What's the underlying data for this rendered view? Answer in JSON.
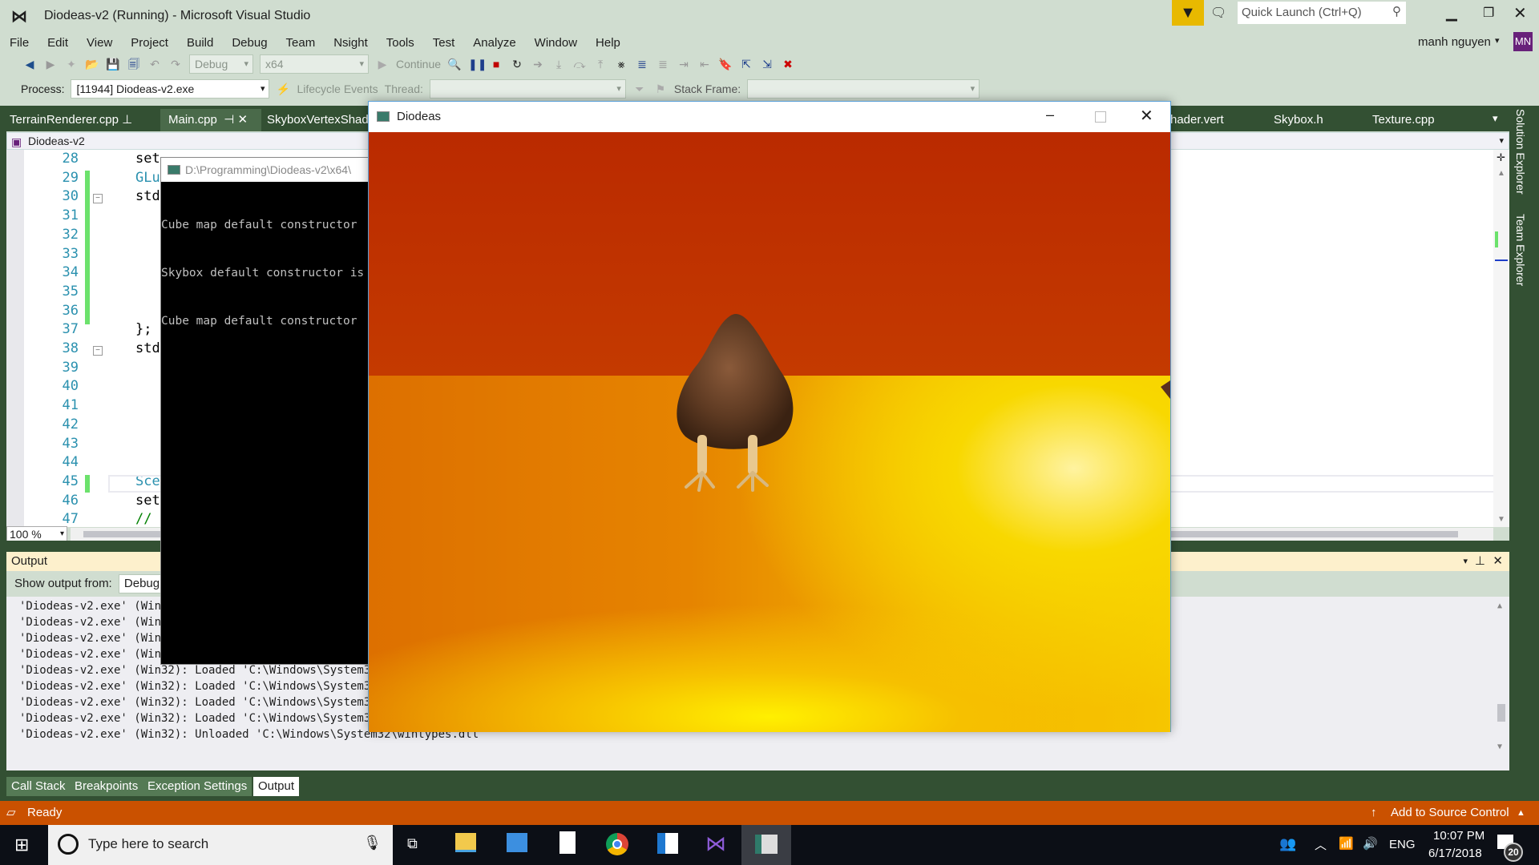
{
  "window": {
    "title": "Diodeas-v2 (Running) - Microsoft Visual Studio",
    "quick_launch_placeholder": "Quick Launch (Ctrl+Q)",
    "user": "manh nguyen",
    "avatar": "MN",
    "avatar_color": "#68217a"
  },
  "menu": [
    "File",
    "Edit",
    "View",
    "Project",
    "Build",
    "Debug",
    "Team",
    "Nsight",
    "Tools",
    "Test",
    "Analyze",
    "Window",
    "Help"
  ],
  "toolbar": {
    "config": "Debug",
    "platform": "x64",
    "continue": "Continue"
  },
  "debug_location": {
    "process_label": "Process:",
    "process": "[11944] Diodeas-v2.exe",
    "lifecycle": "Lifecycle Events",
    "thread_label": "Thread:",
    "stack_frame_label": "Stack Frame:"
  },
  "tabs": [
    "TerrainRenderer.cpp",
    "Main.cpp",
    "SkyboxVertexShade",
    "hader.vert",
    "Skybox.h",
    "Texture.cpp"
  ],
  "navbar": {
    "project": "Diodeas-v2"
  },
  "editor": {
    "zoom": "100 %",
    "lines": [
      {
        "n": "28",
        "t": "set",
        "c": "#000"
      },
      {
        "n": "29",
        "t": "GLu",
        "c": "#2b91af"
      },
      {
        "n": "30",
        "t": "std",
        "c": "#000"
      },
      {
        "n": "31",
        "t": ""
      },
      {
        "n": "32",
        "t": ""
      },
      {
        "n": "33",
        "t": ""
      },
      {
        "n": "34",
        "t": ""
      },
      {
        "n": "35",
        "t": ""
      },
      {
        "n": "36",
        "t": ""
      },
      {
        "n": "37",
        "t": "};",
        "c": "#000"
      },
      {
        "n": "38",
        "t": "std",
        "c": "#000"
      },
      {
        "n": "39",
        "t": ""
      },
      {
        "n": "40",
        "t": ""
      },
      {
        "n": "41",
        "t": ""
      },
      {
        "n": "42",
        "t": ""
      },
      {
        "n": "43",
        "t": ""
      },
      {
        "n": "44",
        "t": ""
      },
      {
        "n": "45",
        "t": "Sce",
        "c": "#2b91af"
      },
      {
        "n": "46",
        "t": "set",
        "c": "#000"
      },
      {
        "n": "47",
        "t": "//",
        "c": "#008000"
      }
    ]
  },
  "console": {
    "title": "D:\\Programming\\Diodeas-v2\\x64\\",
    "lines": [
      "Cube map default constructor",
      "Skybox default constructor is",
      "Cube map default constructor"
    ]
  },
  "game": {
    "title": "Diodeas"
  },
  "output": {
    "title": "Output",
    "show_from_label": "Show output from:",
    "source": "Debug",
    "lines": [
      "'Diodeas-v2.exe' (Win3",
      "'Diodeas-v2.exe' (Win3",
      "'Diodeas-v2.exe' (Win3",
      "'Diodeas-v2.exe' (Win3",
      "'Diodeas-v2.exe' (Win32): Loaded 'C:\\Windows\\System32\\",
      "'Diodeas-v2.exe' (Win32): Loaded 'C:\\Windows\\System32\\",
      "'Diodeas-v2.exe' (Win32): Loaded 'C:\\Windows\\System32\\",
      "'Diodeas-v2.exe' (Win32): Loaded 'C:\\Windows\\System32\\",
      "'Diodeas-v2.exe' (Win32): Unloaded 'C:\\Windows\\System32\\wintypes.dll"
    ]
  },
  "bottom_tabs": [
    "Call Stack",
    "Breakpoints",
    "Exception Settings",
    "Output"
  ],
  "side_tabs": [
    "Solution Explorer",
    "Team Explorer"
  ],
  "status": {
    "text": "Ready",
    "source_control": "Add to Source Control",
    "color": "#ca5100"
  },
  "taskbar": {
    "search_placeholder": "Type here to search",
    "time": "10:07 PM",
    "date": "6/17/2018",
    "lang": "ENG",
    "notifications": "20"
  }
}
